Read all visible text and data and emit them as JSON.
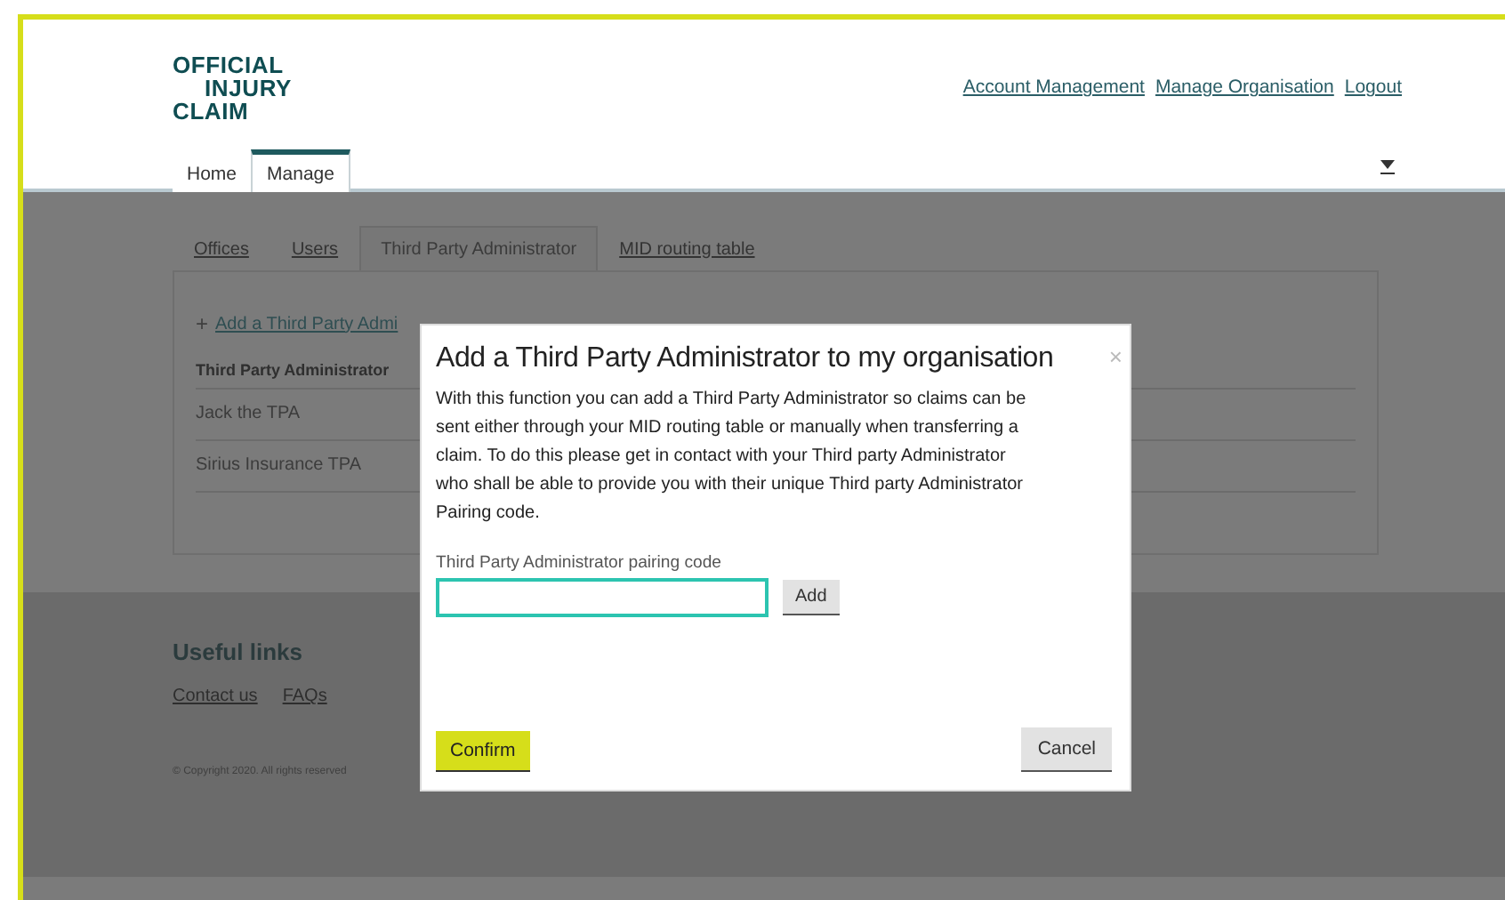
{
  "logo": {
    "lines": [
      "OFFICIAL",
      "INJURY",
      "CLAIM"
    ]
  },
  "header_links": [
    "Account Management",
    "Manage Organisation",
    "Logout"
  ],
  "main_tabs": [
    {
      "label": "Home",
      "selected": false
    },
    {
      "label": "Manage",
      "selected": true
    }
  ],
  "sub_tabs": [
    {
      "label": "Offices",
      "selected": false
    },
    {
      "label": "Users",
      "selected": false
    },
    {
      "label": "Third Party Administrator",
      "selected": true
    },
    {
      "label": "MID routing table",
      "selected": false
    }
  ],
  "add_link": {
    "icon": "+",
    "label": "Add a Third Party Admi"
  },
  "table": {
    "header": "Third Party Administrator",
    "rows": [
      "Jack the TPA",
      "Sirius Insurance TPA"
    ]
  },
  "footer": {
    "title": "Useful links",
    "links": [
      "Contact us",
      "FAQs"
    ],
    "copyright": "© Copyright 2020. All rights reserved"
  },
  "dialog": {
    "title": "Add a Third Party Administrator to my organisation",
    "close": "×",
    "body": "With this function you can add a Third Party Administrator so claims can be sent either through your MID routing table or manually when transferring a claim. To do this please get in contact with your Third party Administrator who shall be able to provide you with their unique Third party Administrator Pairing code.",
    "field_label": "Third Party Administrator pairing code",
    "field_focused": true,
    "add_button": "Add",
    "confirm": "Confirm",
    "cancel": "Cancel"
  }
}
